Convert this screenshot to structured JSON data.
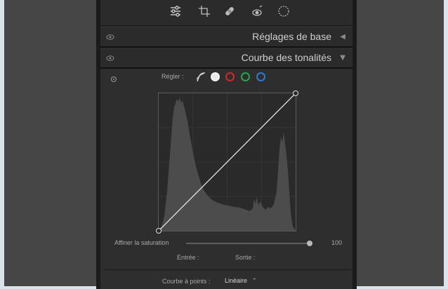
{
  "toolbar": {
    "icons": [
      "sliders-icon",
      "crop-icon",
      "bandage-icon",
      "redeye-icon",
      "mask-icon"
    ]
  },
  "sections": {
    "basic": {
      "title": "Réglages de base",
      "arrow": "◀"
    },
    "tone_curve": {
      "title": "Courbe des tonalités",
      "arrow": "▼"
    }
  },
  "tone_curve": {
    "adjust_label": "Régler :",
    "channels": [
      "parametric",
      "white",
      "red",
      "green",
      "blue"
    ],
    "channel_colors": {
      "white": "#e8e8e8",
      "red": "#d8262a",
      "green": "#22a84a",
      "blue": "#2c7ad6"
    },
    "saturation_label": "Affiner la saturation",
    "saturation_value": "100",
    "input_label": "Entrée :",
    "output_label": "Sortie :",
    "point_curve_label": "Courbe à points :",
    "point_curve_value": "Linéaire",
    "point_curve_arrow": "⌃"
  }
}
